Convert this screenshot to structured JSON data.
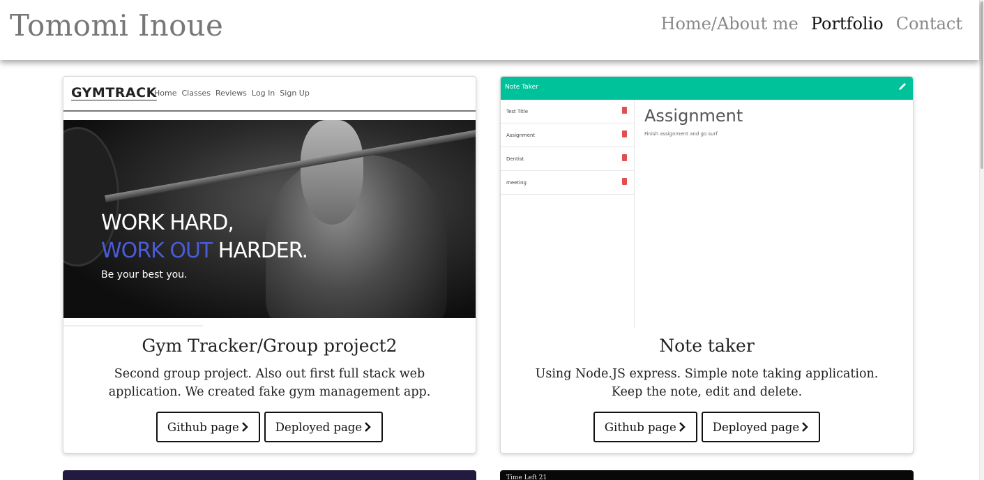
{
  "site": {
    "brand": "Tomomi Inoue"
  },
  "nav": [
    {
      "label": "Home/About me",
      "active": false
    },
    {
      "label": "Portfolio",
      "active": true
    },
    {
      "label": "Contact",
      "active": false
    }
  ],
  "projects": [
    {
      "title": "Gym Tracker/Group project2",
      "description": "Second group project. Also out first full stack web application. We created fake gym management app.",
      "buttons": {
        "github": "Github page",
        "deployed": "Deployed page"
      },
      "thumbnail": {
        "logo": "GYMTRACK",
        "links": [
          "Home",
          "Classes",
          "Reviews",
          "Log In",
          "Sign Up"
        ],
        "headline_line1": "WORK HARD,",
        "headline_blue": "WORK OUT",
        "headline_rest": " HARDER.",
        "subline": "Be your best you."
      }
    },
    {
      "title": "Note taker",
      "description": "Using Node.JS express. Simple note taking application. Keep the note, edit and delete.",
      "buttons": {
        "github": "Github page",
        "deployed": "Deployed page"
      },
      "thumbnail": {
        "app_name": "Note Taker",
        "notes": [
          "Test Title",
          "Assignment",
          "Dentist",
          "meeting"
        ],
        "active_title": "Assignment",
        "active_text": "Finish assignment and go surf"
      }
    }
  ],
  "peek": {
    "card4_text": "Time Left 21"
  },
  "colors": {
    "note_header": "#00c29a",
    "gym_accent": "#4a5cd8",
    "peek1": "#221a3f",
    "peek2": "#080808"
  }
}
